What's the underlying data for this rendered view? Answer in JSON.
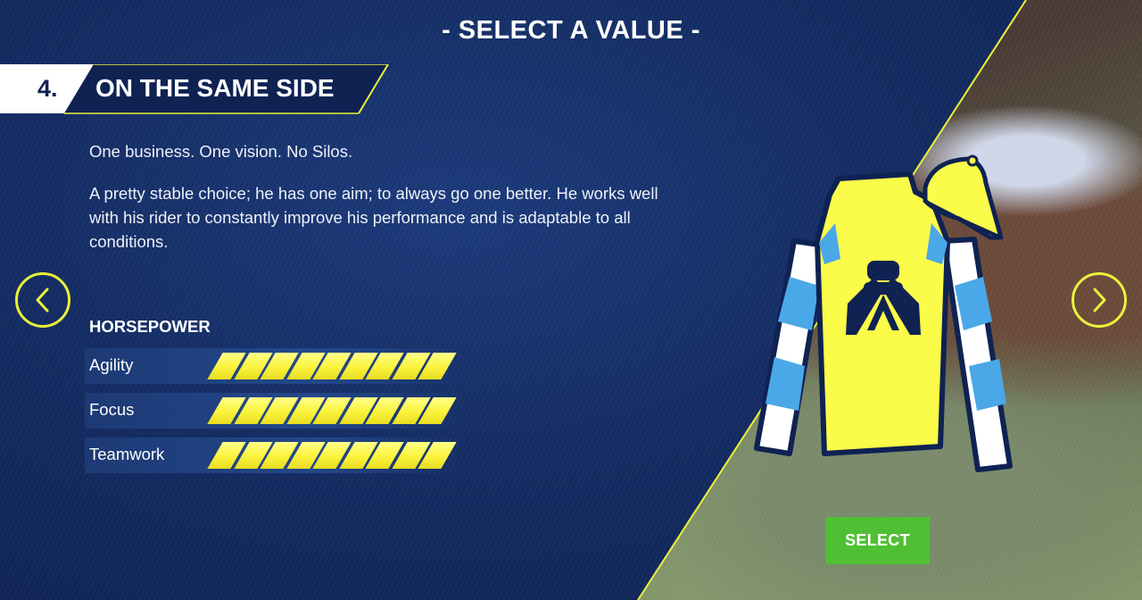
{
  "header": {
    "title": "- SELECT A VALUE -"
  },
  "value": {
    "number": "4.",
    "title": "ON THE SAME SIDE",
    "tagline": "One business. One vision. No Silos.",
    "description": "A pretty stable choice; he has one aim; to always go one better. He works well with his rider to constantly improve his performance and is adaptable to all conditions."
  },
  "stats": {
    "heading": "HORSEPOWER",
    "max": 9,
    "items": [
      {
        "label": "Agility",
        "value": 9
      },
      {
        "label": "Focus",
        "value": 9
      },
      {
        "label": "Teamwork",
        "value": 9
      }
    ]
  },
  "nav": {
    "prev_icon": "chevron-left-icon",
    "next_icon": "chevron-right-icon"
  },
  "silks": {
    "body_color": "#fbfb4a",
    "sleeve_colors": [
      "#ffffff",
      "#4aa8e8"
    ],
    "emblem": "handshake-icon",
    "outline": "#0f2252"
  },
  "actions": {
    "select_label": "SELECT"
  },
  "colors": {
    "accent": "#e9f23a",
    "background": "#13285c",
    "select_green": "#4fbf34"
  }
}
